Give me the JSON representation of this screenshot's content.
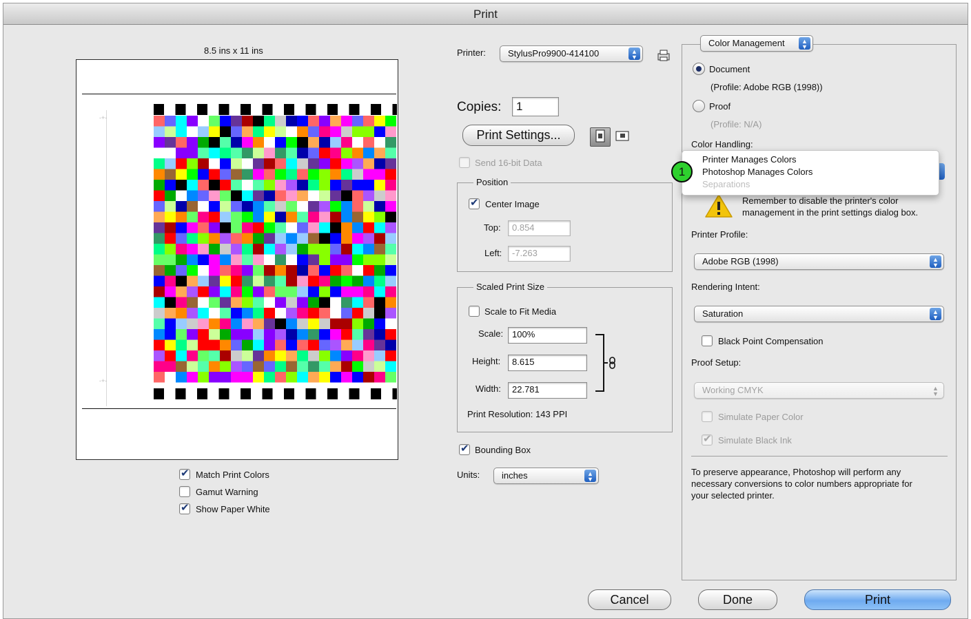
{
  "window": {
    "title": "Print"
  },
  "preview": {
    "paper_size": "8.5 ins x 11 ins",
    "options": [
      {
        "label": "Match Print Colors",
        "checked": true
      },
      {
        "label": "Gamut Warning",
        "checked": false
      },
      {
        "label": "Show Paper White",
        "checked": true
      }
    ]
  },
  "middle": {
    "printer_label": "Printer:",
    "printer_value": "StylusPro9900-414100",
    "copies_label": "Copies:",
    "copies_value": "1",
    "print_settings_button": "Print Settings...",
    "send16_label": "Send 16-bit Data",
    "position": {
      "legend": "Position",
      "center_image_label": "Center Image",
      "top_label": "Top:",
      "top_value": "0.854",
      "left_label": "Left:",
      "left_value": "-7.263"
    },
    "scaled": {
      "legend": "Scaled Print Size",
      "scale_to_fit_label": "Scale to Fit Media",
      "scale_label": "Scale:",
      "scale_value": "100%",
      "height_label": "Height:",
      "height_value": "8.615",
      "width_label": "Width:",
      "width_value": "22.781",
      "resolution": "Print Resolution: 143 PPI"
    },
    "bounding_box_label": "Bounding Box",
    "units_label": "Units:",
    "units_value": "inches"
  },
  "color": {
    "section_popup": "Color Management",
    "document_label": "Document",
    "document_profile": "(Profile: Adobe RGB (1998))",
    "proof_label": "Proof",
    "proof_profile": "(Profile: N/A)",
    "color_handling_label": "Color Handling:",
    "color_handling_menu": [
      "Printer Manages Colors",
      "Photoshop Manages Colors",
      "Separations"
    ],
    "step_badge": "1",
    "warning_text_1": "Remember to disable the printer's color",
    "warning_text_2": "management in the print settings dialog box.",
    "printer_profile_label": "Printer Profile:",
    "printer_profile_value": "Adobe RGB (1998)",
    "rendering_intent_label": "Rendering Intent:",
    "rendering_intent_value": "Saturation",
    "black_point_label": "Black Point Compensation",
    "proof_setup_label": "Proof Setup:",
    "proof_setup_value": "Working CMYK",
    "simulate_paper_label": "Simulate Paper Color",
    "simulate_ink_label": "Simulate Black Ink",
    "description_1": "To preserve appearance, Photoshop will perform any",
    "description_2": "necessary conversions to color numbers appropriate for",
    "description_3": "your selected printer."
  },
  "buttons": {
    "cancel": "Cancel",
    "done": "Done",
    "print": "Print"
  },
  "colors": {
    "accent_blue": "#2a66c7",
    "badge_green": "#2ed12e",
    "warning_yellow": "#f2c40c"
  }
}
